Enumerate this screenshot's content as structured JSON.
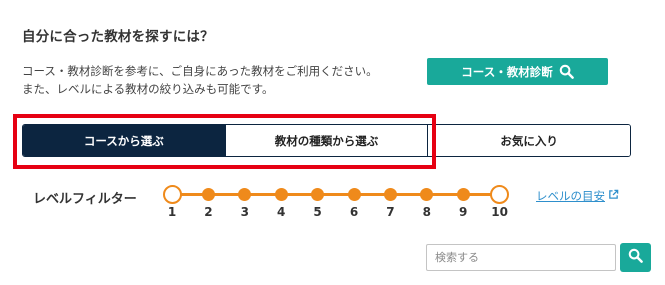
{
  "heading": "自分に合った教材を探すには？",
  "description": {
    "line1": "コース・教材診断を参考に、ご自身にあった教材をご利用ください。",
    "line2": "また、レベルによる教材の絞り込みも可能です。"
  },
  "diagnosis_button": {
    "label": "コース・教材診断",
    "icon": "search-icon"
  },
  "tabs": [
    {
      "label": "コースから選ぶ",
      "active": true
    },
    {
      "label": "教材の種類から選ぶ",
      "active": false
    },
    {
      "label": "お気に入り",
      "active": false
    }
  ],
  "level_filter": {
    "label": "レベルフィルター",
    "levels": [
      "1",
      "2",
      "3",
      "4",
      "5",
      "6",
      "7",
      "8",
      "9",
      "10"
    ],
    "selected_min": 1,
    "selected_max": 10
  },
  "level_guide_link": {
    "label": "レベルの目安",
    "icon": "external-link-icon"
  },
  "search": {
    "placeholder": "検索する",
    "value": "",
    "button_icon": "search-icon"
  },
  "colors": {
    "teal": "#19a99a",
    "navy": "#0c2540",
    "orange": "#ef8a1b",
    "highlight_red": "#e60012",
    "link_blue": "#2e8fcc"
  }
}
